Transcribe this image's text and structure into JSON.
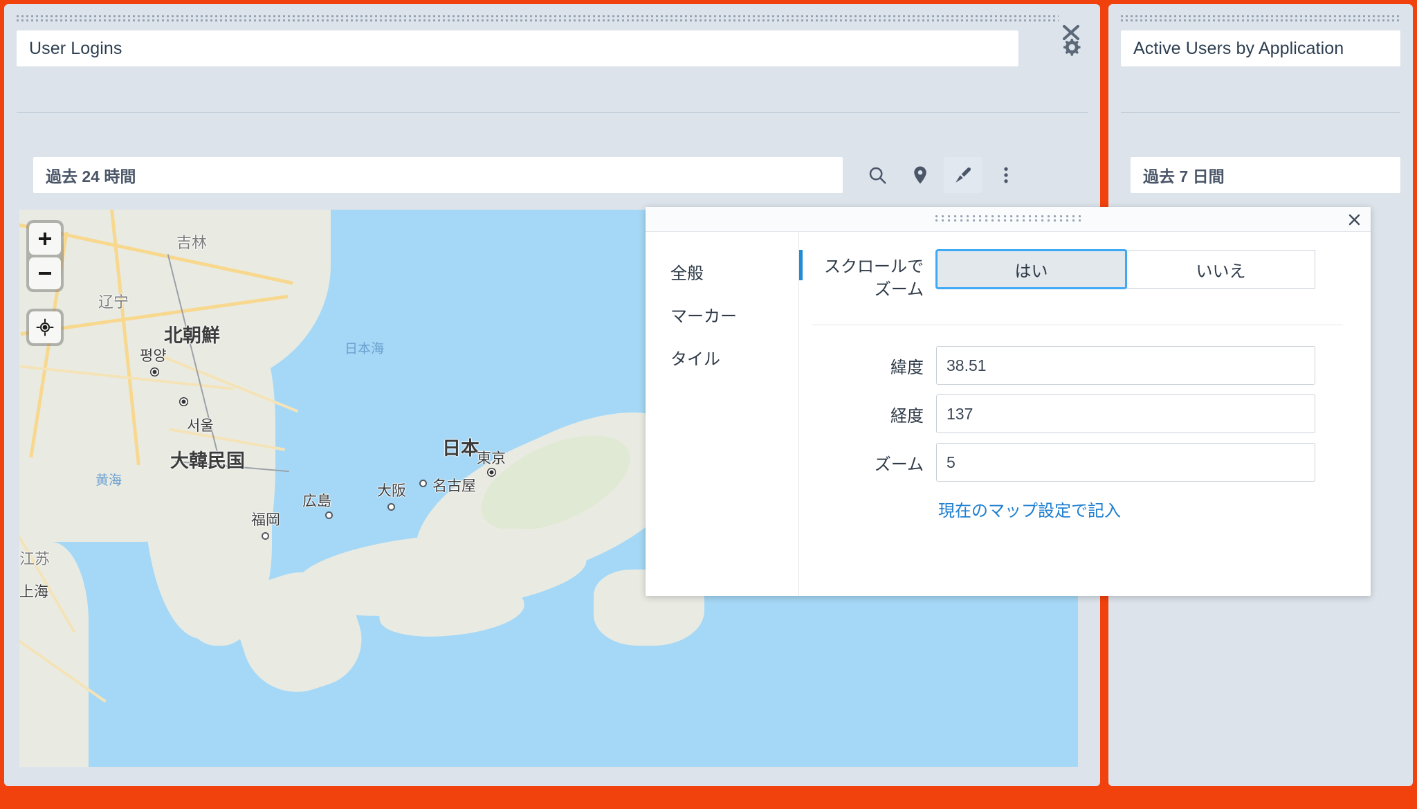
{
  "theme": {
    "page_background": "#F1410D",
    "panel_background": "#DCE3EB",
    "accent_blue": "#1F8CD6",
    "link_blue": "#1F7FD0",
    "selected_toggle_border": "#3FA9F5"
  },
  "panels": [
    {
      "id": "user-logins",
      "title": "User Logins",
      "time_range": "過去 24 時間",
      "settings_icon": "gear-icon",
      "toolbar": [
        {
          "icon": "search-icon",
          "active": false
        },
        {
          "icon": "map-pin-icon",
          "active": false
        },
        {
          "icon": "paintbrush-icon",
          "active": true
        },
        {
          "icon": "more-vertical-icon",
          "active": false
        }
      ]
    },
    {
      "id": "active-users-by-application",
      "title": "Active Users by Application",
      "time_range": "過去 7 日間"
    }
  ],
  "map": {
    "controls": [
      {
        "name": "zoom-in-button",
        "glyph": "+"
      },
      {
        "name": "zoom-out-button",
        "glyph": "−"
      },
      {
        "name": "locate-me-button",
        "glyph": "locate-icon"
      }
    ],
    "labels": {
      "countries": [
        "北朝鮮",
        "大韓民国",
        "日本"
      ],
      "provinces": [
        "吉林",
        "辽宁",
        "江苏"
      ],
      "cities": [
        "평양",
        "서울",
        "上海",
        "福岡",
        "広島",
        "大阪",
        "名古屋",
        "東京"
      ],
      "seas": [
        "日本海",
        "黄海"
      ]
    }
  },
  "dialog": {
    "title_bar": {
      "drag_handle": "drag-dots-handle",
      "close_icon": "close-icon"
    },
    "nav_items": [
      {
        "label": "全般",
        "selected": true
      },
      {
        "label": "マーカー",
        "selected": false
      },
      {
        "label": "タイル",
        "selected": false
      }
    ],
    "scroll_zoom": {
      "label": "スクロールでズーム",
      "options": [
        {
          "label": "はい",
          "selected": true
        },
        {
          "label": "いいえ",
          "selected": false
        }
      ]
    },
    "fields": [
      {
        "label": "緯度",
        "value": "38.51"
      },
      {
        "label": "経度",
        "value": "137"
      },
      {
        "label": "ズーム",
        "value": "5"
      }
    ],
    "link_label": "現在のマップ設定で記入"
  }
}
